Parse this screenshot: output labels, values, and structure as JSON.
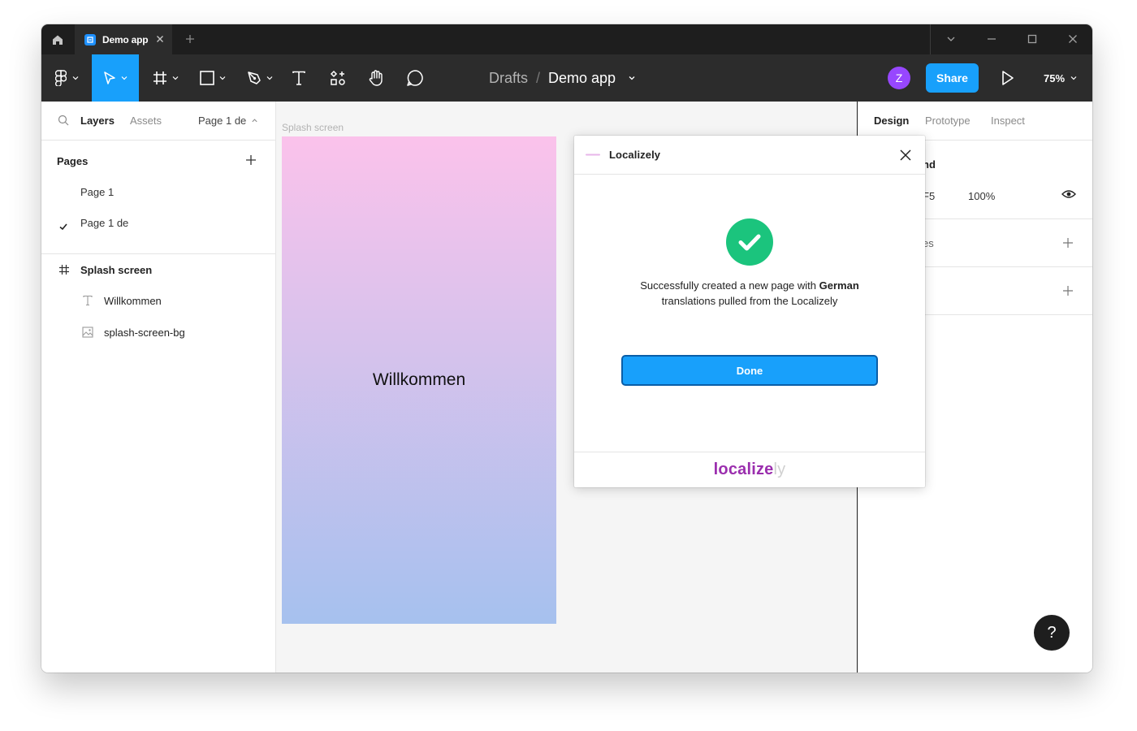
{
  "titlebar": {
    "tab_title": "Demo app"
  },
  "toolbar": {
    "breadcrumb_drafts": "Drafts",
    "breadcrumb_separator": "/",
    "breadcrumb_file": "Demo app",
    "avatar_initial": "Z",
    "share_label": "Share",
    "zoom_level": "75%"
  },
  "left_panel": {
    "tab_layers": "Layers",
    "tab_assets": "Assets",
    "current_page": "Page 1 de",
    "pages_title": "Pages",
    "pages": [
      {
        "label": "Page 1",
        "selected": false
      },
      {
        "label": "Page 1 de",
        "selected": true
      }
    ],
    "layers": [
      {
        "label": "Splash screen",
        "type": "frame"
      },
      {
        "label": "Willkommen",
        "type": "text"
      },
      {
        "label": "splash-screen-bg",
        "type": "image"
      }
    ]
  },
  "canvas": {
    "frame_label": "Splash screen",
    "frame_text": "Willkommen",
    "gradient_top": "#fbc2eb",
    "gradient_bottom": "#a6c1ee"
  },
  "right_panel": {
    "tab_design": "Design",
    "tab_prototype": "Prototype",
    "tab_inspect": "Inspect",
    "bg_title_fragment": "nd",
    "bg_hex_fragment": "F5",
    "bg_opacity": "100%",
    "styles_fragment": "es"
  },
  "modal": {
    "title": "Localizely",
    "message_prefix": "Successfully created a new page with",
    "message_language": "German",
    "message_suffix": "translations pulled from the Localizely",
    "done_label": "Done",
    "brand_main": "localize",
    "brand_fade": "ly"
  },
  "colors": {
    "accent": "#18a0fb",
    "success": "#1bc47d",
    "avatar": "#9747ff",
    "brand": "#9b2fae"
  }
}
